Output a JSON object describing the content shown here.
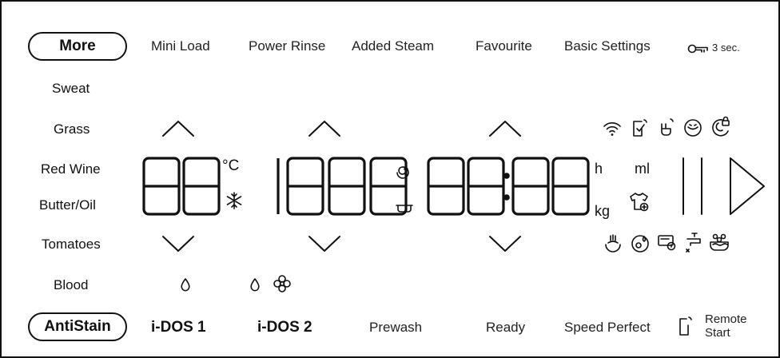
{
  "top_bar": {
    "more": "More",
    "mini_load": "Mini Load",
    "power_rinse": "Power Rinse",
    "added_steam": "Added Steam",
    "favourite": "Favourite",
    "basic_settings": "Basic Settings",
    "key_hold": "3 sec."
  },
  "stain_list": [
    "Sweat",
    "Grass",
    "Red Wine",
    "Butter/Oil",
    "Tomatoes",
    "Blood"
  ],
  "display": {
    "temp_unit": "°C",
    "hours_unit": "h",
    "volume_unit": "ml",
    "weight_unit": "kg"
  },
  "bottom_bar": {
    "antistain": "AntiStain",
    "idos1": "i-DOS 1",
    "idos2": "i-DOS 2",
    "prewash": "Prewash",
    "ready": "Ready",
    "speed_perfect": "Speed Perfect",
    "remote_start": [
      "Remote",
      "Start"
    ]
  },
  "icons": {
    "top_row": [
      "wifi-icon",
      "phone-connect-icon",
      "hand-touch-icon",
      "drum-clean-icon",
      "child-lock-icon"
    ],
    "bottom_row": [
      "steam-icon",
      "dosing-icon",
      "filter-alert-icon",
      "water-tap-icon",
      "bubbles-icon"
    ],
    "temp": "snowflake-icon",
    "spin": "spiral-icon",
    "load": "tshirt-icon"
  }
}
